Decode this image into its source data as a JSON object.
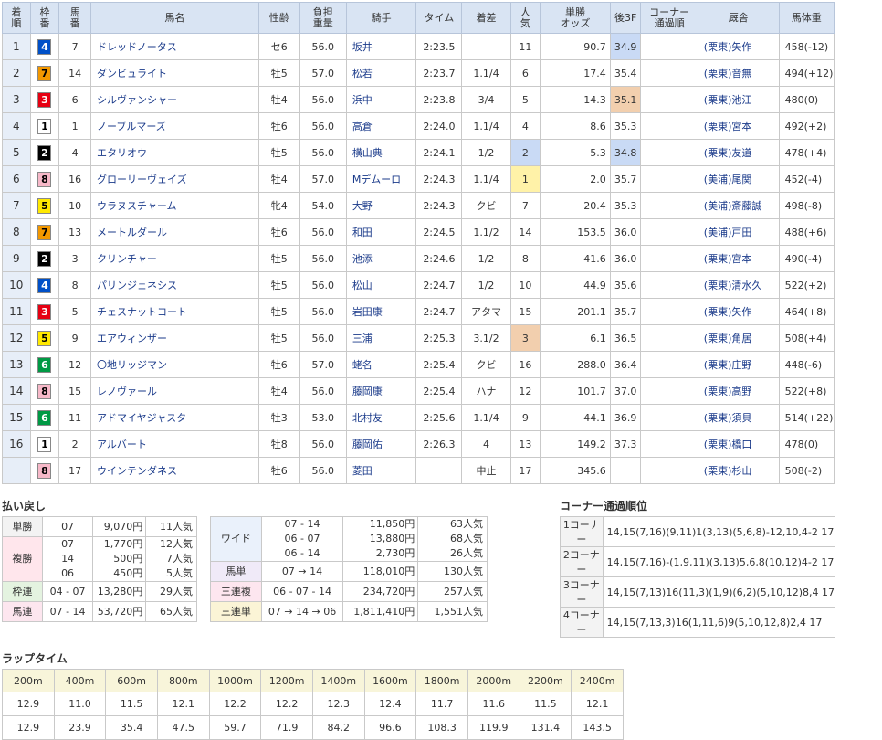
{
  "results": {
    "headers": [
      "着順",
      "枠番",
      "馬番",
      "馬名",
      "性齢",
      "負担重量",
      "騎手",
      "タイム",
      "着差",
      "人気",
      "単勝オッズ",
      "後3F",
      "コーナー通過順",
      "厩舎",
      "馬体重"
    ],
    "header_lines": {
      "rank": [
        "着",
        "順"
      ],
      "waku": [
        "枠",
        "番"
      ],
      "umaban": [
        "馬",
        "番"
      ],
      "weight": [
        "負担",
        "重量"
      ],
      "pop": [
        "人",
        "気"
      ],
      "odds": [
        "単勝",
        "オッズ"
      ],
      "corner": [
        "コーナー",
        "通過順"
      ]
    },
    "rows": [
      {
        "rank": "1",
        "waku": "4",
        "umaban": "7",
        "name": "ドレッドノータス",
        "sexage": "セ6",
        "weight": "56.0",
        "jockey": "坂井",
        "time": "2:23.5",
        "margin": "",
        "pop": "11",
        "odds": "90.7",
        "last3f": "34.9",
        "corner": "",
        "trainer": "(栗東)矢作",
        "bodyweight": "458(-12)",
        "pophl": "",
        "lasthl": "1"
      },
      {
        "rank": "2",
        "waku": "7",
        "umaban": "14",
        "name": "ダンビュライト",
        "sexage": "牡5",
        "weight": "57.0",
        "jockey": "松若",
        "time": "2:23.7",
        "margin": "1.1/4",
        "pop": "6",
        "odds": "17.4",
        "last3f": "35.4",
        "corner": "",
        "trainer": "(栗東)音無",
        "bodyweight": "494(+12)",
        "pophl": "",
        "lasthl": ""
      },
      {
        "rank": "3",
        "waku": "3",
        "umaban": "6",
        "name": "シルヴァンシャー",
        "sexage": "牡4",
        "weight": "56.0",
        "jockey": "浜中",
        "time": "2:23.8",
        "margin": "3/4",
        "pop": "5",
        "odds": "14.3",
        "last3f": "35.1",
        "corner": "",
        "trainer": "(栗東)池江",
        "bodyweight": "480(0)",
        "pophl": "",
        "lasthl": "2"
      },
      {
        "rank": "4",
        "waku": "1",
        "umaban": "1",
        "name": "ノーブルマーズ",
        "sexage": "牡6",
        "weight": "56.0",
        "jockey": "高倉",
        "time": "2:24.0",
        "margin": "1.1/4",
        "pop": "4",
        "odds": "8.6",
        "last3f": "35.3",
        "corner": "",
        "trainer": "(栗東)宮本",
        "bodyweight": "492(+2)",
        "pophl": "",
        "lasthl": ""
      },
      {
        "rank": "5",
        "waku": "2",
        "umaban": "4",
        "name": "エタリオウ",
        "sexage": "牡5",
        "weight": "56.0",
        "jockey": "横山典",
        "time": "2:24.1",
        "margin": "1/2",
        "pop": "2",
        "odds": "5.3",
        "last3f": "34.8",
        "corner": "",
        "trainer": "(栗東)友道",
        "bodyweight": "478(+4)",
        "pophl": "2",
        "lasthl": "3"
      },
      {
        "rank": "6",
        "waku": "8",
        "umaban": "16",
        "name": "グローリーヴェイズ",
        "sexage": "牡4",
        "weight": "57.0",
        "jockey": "Mデムーロ",
        "time": "2:24.3",
        "margin": "1.1/4",
        "pop": "1",
        "odds": "2.0",
        "last3f": "35.7",
        "corner": "",
        "trainer": "(美浦)尾関",
        "bodyweight": "452(-4)",
        "pophl": "1",
        "lasthl": ""
      },
      {
        "rank": "7",
        "waku": "5",
        "umaban": "10",
        "name": "ウラヌスチャーム",
        "sexage": "牝4",
        "weight": "54.0",
        "jockey": "大野",
        "time": "2:24.3",
        "margin": "クビ",
        "pop": "7",
        "odds": "20.4",
        "last3f": "35.3",
        "corner": "",
        "trainer": "(美浦)斎藤誠",
        "bodyweight": "498(-8)",
        "pophl": "",
        "lasthl": ""
      },
      {
        "rank": "8",
        "waku": "7",
        "umaban": "13",
        "name": "メートルダール",
        "sexage": "牡6",
        "weight": "56.0",
        "jockey": "和田",
        "time": "2:24.5",
        "margin": "1.1/2",
        "pop": "14",
        "odds": "153.5",
        "last3f": "36.0",
        "corner": "",
        "trainer": "(美浦)戸田",
        "bodyweight": "488(+6)",
        "pophl": "",
        "lasthl": ""
      },
      {
        "rank": "9",
        "waku": "2",
        "umaban": "3",
        "name": "クリンチャー",
        "sexage": "牡5",
        "weight": "56.0",
        "jockey": "池添",
        "time": "2:24.6",
        "margin": "1/2",
        "pop": "8",
        "odds": "41.6",
        "last3f": "36.0",
        "corner": "",
        "trainer": "(栗東)宮本",
        "bodyweight": "490(-4)",
        "pophl": "",
        "lasthl": ""
      },
      {
        "rank": "10",
        "waku": "4",
        "umaban": "8",
        "name": "パリンジェネシス",
        "sexage": "牡5",
        "weight": "56.0",
        "jockey": "松山",
        "time": "2:24.7",
        "margin": "1/2",
        "pop": "10",
        "odds": "44.9",
        "last3f": "35.6",
        "corner": "",
        "trainer": "(栗東)清水久",
        "bodyweight": "522(+2)",
        "pophl": "",
        "lasthl": ""
      },
      {
        "rank": "11",
        "waku": "3",
        "umaban": "5",
        "name": "チェスナットコート",
        "sexage": "牡5",
        "weight": "56.0",
        "jockey": "岩田康",
        "time": "2:24.7",
        "margin": "アタマ",
        "pop": "15",
        "odds": "201.1",
        "last3f": "35.7",
        "corner": "",
        "trainer": "(栗東)矢作",
        "bodyweight": "464(+8)",
        "pophl": "",
        "lasthl": ""
      },
      {
        "rank": "12",
        "waku": "5",
        "umaban": "9",
        "name": "エアウィンザー",
        "sexage": "牡5",
        "weight": "56.0",
        "jockey": "三浦",
        "time": "2:25.3",
        "margin": "3.1/2",
        "pop": "3",
        "odds": "6.1",
        "last3f": "36.5",
        "corner": "",
        "trainer": "(栗東)角居",
        "bodyweight": "508(+4)",
        "pophl": "3",
        "lasthl": ""
      },
      {
        "rank": "13",
        "waku": "6",
        "umaban": "12",
        "name": "〇地リッジマン",
        "sexage": "牡6",
        "weight": "57.0",
        "jockey": "蛯名",
        "time": "2:25.4",
        "margin": "クビ",
        "pop": "16",
        "odds": "288.0",
        "last3f": "36.4",
        "corner": "",
        "trainer": "(栗東)庄野",
        "bodyweight": "448(-6)",
        "pophl": "",
        "lasthl": ""
      },
      {
        "rank": "14",
        "waku": "8",
        "umaban": "15",
        "name": "レノヴァール",
        "sexage": "牡4",
        "weight": "56.0",
        "jockey": "藤岡康",
        "time": "2:25.4",
        "margin": "ハナ",
        "pop": "12",
        "odds": "101.7",
        "last3f": "37.0",
        "corner": "",
        "trainer": "(栗東)高野",
        "bodyweight": "522(+8)",
        "pophl": "",
        "lasthl": ""
      },
      {
        "rank": "15",
        "waku": "6",
        "umaban": "11",
        "name": "アドマイヤジャスタ",
        "sexage": "牡3",
        "weight": "53.0",
        "jockey": "北村友",
        "time": "2:25.6",
        "margin": "1.1/4",
        "pop": "9",
        "odds": "44.1",
        "last3f": "36.9",
        "corner": "",
        "trainer": "(栗東)須貝",
        "bodyweight": "514(+22)",
        "pophl": "",
        "lasthl": ""
      },
      {
        "rank": "16",
        "waku": "1",
        "umaban": "2",
        "name": "アルバート",
        "sexage": "牡8",
        "weight": "56.0",
        "jockey": "藤岡佑",
        "time": "2:26.3",
        "margin": "4",
        "pop": "13",
        "odds": "149.2",
        "last3f": "37.3",
        "corner": "",
        "trainer": "(栗東)橋口",
        "bodyweight": "478(0)",
        "pophl": "",
        "lasthl": ""
      },
      {
        "rank": "",
        "waku": "8",
        "umaban": "17",
        "name": "ウインテンダネス",
        "sexage": "牡6",
        "weight": "56.0",
        "jockey": "菱田",
        "time": "",
        "margin": "中止",
        "pop": "17",
        "odds": "345.6",
        "last3f": "",
        "corner": "",
        "trainer": "(栗東)杉山",
        "bodyweight": "508(-2)",
        "pophl": "",
        "lasthl": ""
      }
    ]
  },
  "waku_colors": {
    "1": {
      "bg": "#ffffff",
      "fg": "#000000"
    },
    "2": {
      "bg": "#000000",
      "fg": "#ffffff"
    },
    "3": {
      "bg": "#e60012",
      "fg": "#ffffff"
    },
    "4": {
      "bg": "#0050c8",
      "fg": "#ffffff"
    },
    "5": {
      "bg": "#ffe900",
      "fg": "#000000"
    },
    "6": {
      "bg": "#009944",
      "fg": "#ffffff"
    },
    "7": {
      "bg": "#f39800",
      "fg": "#000000"
    },
    "8": {
      "bg": "#f7b8c8",
      "fg": "#000000"
    }
  },
  "payout": {
    "title": "払い戻し",
    "left": [
      {
        "label": "単勝",
        "combo": "07",
        "amount": "9,070円",
        "pop": "11人気",
        "bg": "#f3f3f3"
      },
      {
        "label": "複勝",
        "combo": "07\n14\n06",
        "amount": "1,770円\n500円\n450円",
        "pop": "12人気\n7人気\n5人気",
        "bg": "#ffe6ec"
      },
      {
        "label": "枠連",
        "combo": "04 - 07",
        "amount": "13,280円",
        "pop": "29人気",
        "bg": "#e4f3e0"
      },
      {
        "label": "馬連",
        "combo": "07 - 14",
        "amount": "53,720円",
        "pop": "65人気",
        "bg": "#fde6ef"
      }
    ],
    "right": [
      {
        "label": "ワイド",
        "combo": "07 - 14\n06 - 07\n06 - 14",
        "amount": "11,850円\n13,880円\n2,730円",
        "pop": "63人気\n68人気\n26人気",
        "bg": "#eaf1fb"
      },
      {
        "label": "馬単",
        "combo": "07 → 14",
        "amount": "118,010円",
        "pop": "130人気",
        "bg": "#f0eaf8"
      },
      {
        "label": "三連複",
        "combo": "06 - 07 - 14",
        "amount": "234,720円",
        "pop": "257人気",
        "bg": "#fde6ef"
      },
      {
        "label": "三連単",
        "combo": "07 → 14 → 06",
        "amount": "1,811,410円",
        "pop": "1,551人気",
        "bg": "#fbf4d6"
      }
    ]
  },
  "corner": {
    "title": "コーナー通過順位",
    "rows": [
      {
        "label": "1コーナー",
        "value": "14,15(7,16)(9,11)1(3,13)(5,6,8)-12,10,4-2 17"
      },
      {
        "label": "2コーナー",
        "value": "14,15(7,16)-(1,9,11)(3,13)5,6,8(10,12)4-2 17"
      },
      {
        "label": "3コーナー",
        "value": "14,15(7,13)16(11,3)(1,9)(6,2)(5,10,12)8,4 17"
      },
      {
        "label": "4コーナー",
        "value": "14,15(7,13,3)16(1,11,6)9(5,10,12,8)2,4 17"
      }
    ]
  },
  "lap": {
    "title": "ラップタイム",
    "distances": [
      "200m",
      "400m",
      "600m",
      "800m",
      "1000m",
      "1200m",
      "1400m",
      "1600m",
      "1800m",
      "2000m",
      "2200m",
      "2400m"
    ],
    "laps": [
      "12.9",
      "11.0",
      "11.5",
      "12.1",
      "12.2",
      "12.2",
      "12.3",
      "12.4",
      "11.7",
      "11.6",
      "11.5",
      "12.1"
    ],
    "cumulative": [
      "12.9",
      "23.9",
      "35.4",
      "47.5",
      "59.7",
      "71.9",
      "84.2",
      "96.6",
      "108.3",
      "119.9",
      "131.4",
      "143.5"
    ]
  }
}
